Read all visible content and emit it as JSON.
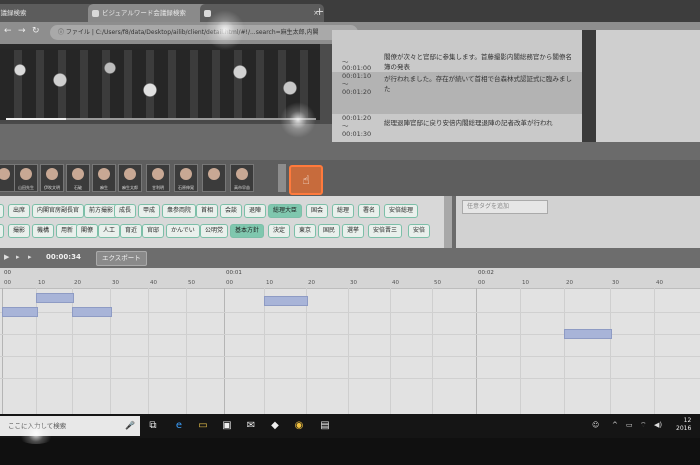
{
  "browser": {
    "tabs": [
      {
        "title": "会議録検索"
      },
      {
        "title": "ビジュアルワード会議録検索"
      },
      {
        "title": ""
      }
    ],
    "new_tab": "+",
    "address": "ⓘ ファイル | C:/Users/f8/data/Desktop/ailib/client/detail.html/#!/...search=麻生太郎,内閣"
  },
  "transcript": [
    {
      "start": "",
      "end": "00:01:00",
      "text": "閣僚が次々と官邸に参集します。首藤撮影内閣総務官から閣僚名簿の発表"
    },
    {
      "start": "00:01:10",
      "end": "00:01:20",
      "text": "が行われました。存在が続いて首相で台森林式認証式に臨みました"
    },
    {
      "start": "00:01:20",
      "end": "00:01:30",
      "text": "総理退陣官邸に戻り安倍内閣総理退陣の記者改革が行われ"
    }
  ],
  "faces": [
    "",
    "山田先生",
    "伊吹文明",
    "石破",
    "麻生",
    "麻生太郎",
    "甘利明",
    "石原伸晃",
    "",
    "高市早苗"
  ],
  "tags": {
    "row1": [
      "",
      "出席",
      "内閣官房副長官",
      "前方撮影",
      "成長",
      "甲成",
      "衆参両院",
      "首相",
      "会談",
      "退陣",
      "総理大臣",
      "国会",
      "総理",
      "署名",
      "安倍総理"
    ],
    "row2": [
      "",
      "撮影",
      "機構",
      "用新",
      "閣僚",
      "人工",
      "育近",
      "官邸",
      "かんでい",
      "公明党",
      "基本方針",
      "決定",
      "東京",
      "国民",
      "選挙",
      "安倍晋三",
      "安倍"
    ],
    "search_placeholder": "任意タグを追加"
  },
  "controls": {
    "time": "00:00:34",
    "export_label": "エクスポート"
  },
  "timeline": {
    "minutes": [
      "00",
      "00:01",
      "00:02"
    ],
    "seconds": [
      "00",
      "10",
      "20",
      "30",
      "40",
      "50"
    ]
  },
  "taskbar": {
    "search_placeholder": "ここに入力して検索",
    "clock_time": "12",
    "clock_date": "2016"
  }
}
